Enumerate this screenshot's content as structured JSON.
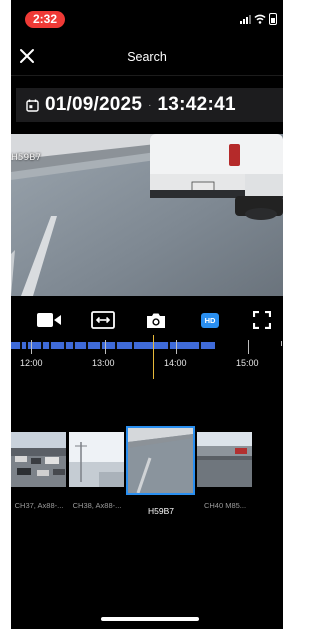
{
  "status_bar": {
    "time": "2:32",
    "icons": [
      "signal-icon",
      "wifi-icon",
      "battery-icon"
    ]
  },
  "header": {
    "title": "Search",
    "close_icon": "close-icon"
  },
  "datetime": {
    "date": "01/09/2025",
    "separator": "·",
    "time": "13:42:41",
    "icon": "calendar-icon"
  },
  "video": {
    "camera_label": "H59B7"
  },
  "controls": {
    "items": [
      {
        "name": "record-video-icon",
        "active": false
      },
      {
        "name": "fit-width-icon",
        "active": false
      },
      {
        "name": "snapshot-camera-icon",
        "active": false
      },
      {
        "name": "hd-quality-toggle",
        "label": "HD",
        "active": true
      },
      {
        "name": "fullscreen-icon",
        "active": false
      }
    ]
  },
  "timeline": {
    "labels": [
      "12:00",
      "13:00",
      "14:00",
      "15:00"
    ],
    "cursor_time": "13:42:41"
  },
  "thumbnails": [
    {
      "caption": "CH37, Ax88-...",
      "selected": false
    },
    {
      "caption": "CH38, Ax88-...",
      "selected": false
    },
    {
      "caption": "H59B7",
      "selected": true
    },
    {
      "caption": "CH40 M85...",
      "selected": false
    }
  ],
  "colors": {
    "background": "#000000",
    "accent_blue": "#2a8ff0",
    "timeline_blue": "#3f6bd9",
    "timeline_cursor": "#e7b93a",
    "status_time_pill": "#ef3a36"
  }
}
